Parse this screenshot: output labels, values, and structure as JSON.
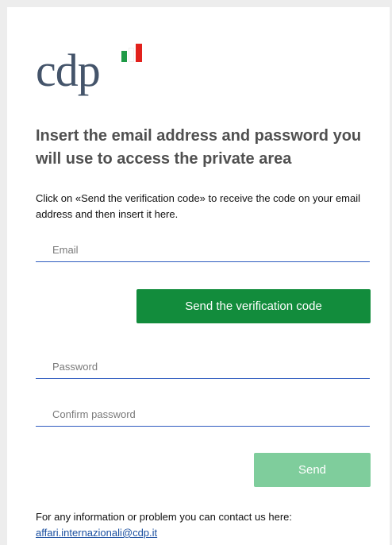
{
  "logo": {
    "text": "cdp",
    "flag_colors": [
      "#1e9a46",
      "#ffffff",
      "#e2211c"
    ]
  },
  "title": "Insert the email address and password you will use to access the private area",
  "description": "Click on «Send the verification code» to receive the code on your email address and then insert it here.",
  "fields": {
    "email_placeholder": "Email",
    "password_placeholder": "Password",
    "confirm_password_placeholder": "Confirm password"
  },
  "buttons": {
    "verify_label": "Send the verification code",
    "send_label": "Send"
  },
  "footer": {
    "text": "For any information or problem you can contact us here:",
    "email_link": "affari.internazionali@cdp.it"
  },
  "colors": {
    "primary_green": "#128c3c",
    "disabled_green": "#7fcd9c",
    "field_underline": "#2e5bbf",
    "link": "#1a4fa0"
  }
}
